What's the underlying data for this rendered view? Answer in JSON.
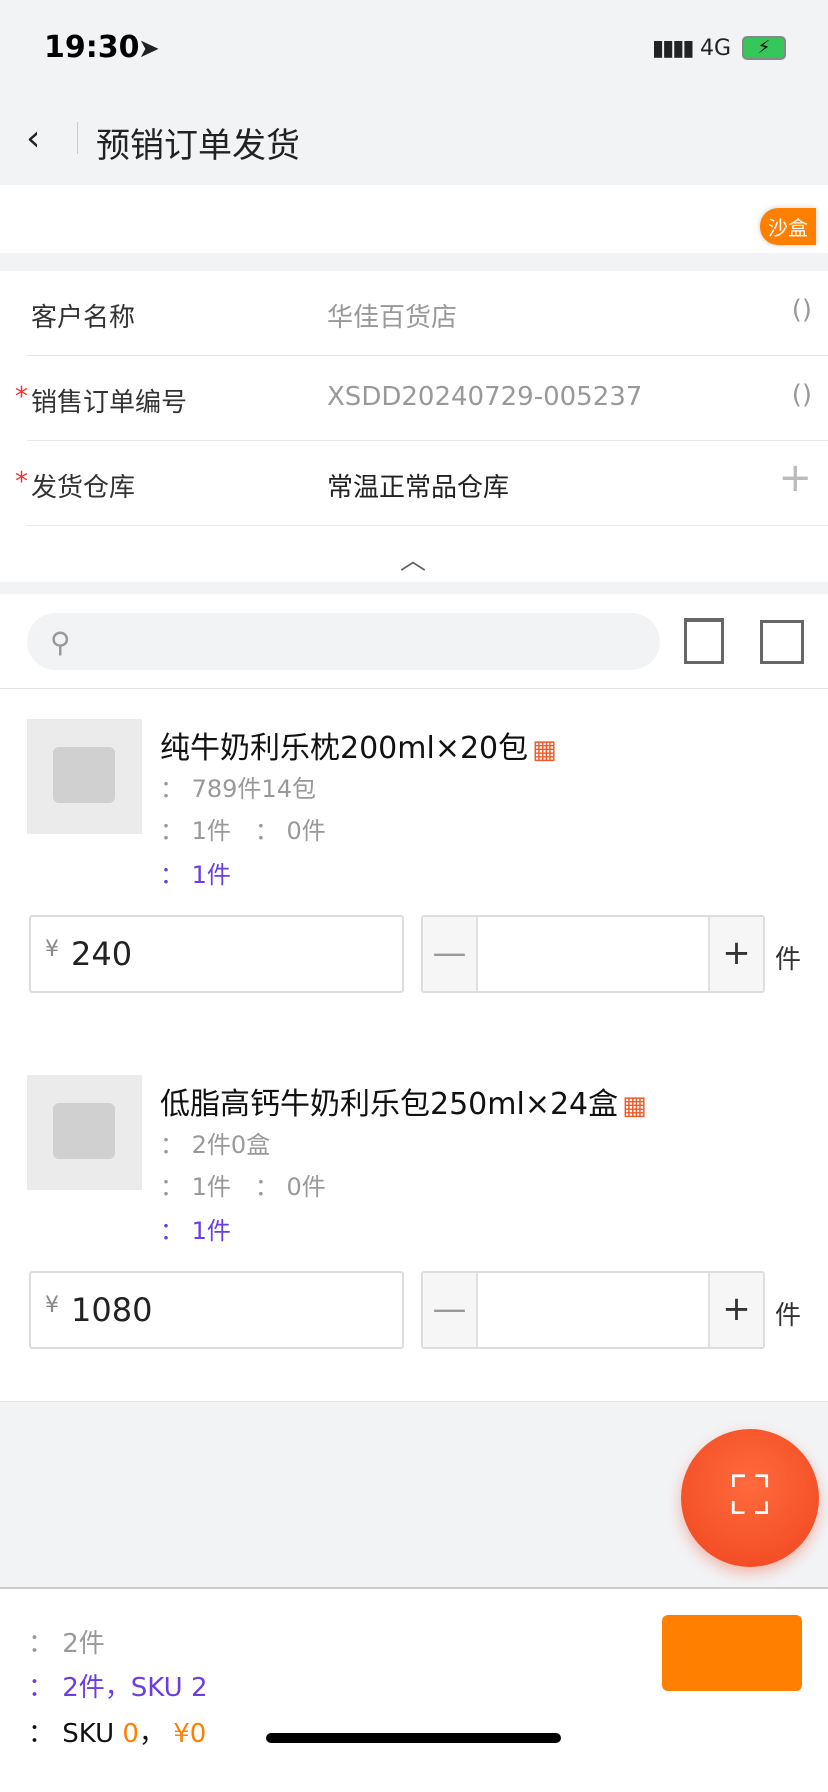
{
  "status": {
    "time": "19:30",
    "network": "4G"
  },
  "nav": {
    "title": "预销订单发货"
  },
  "sandbox": {
    "label": "沙盒"
  },
  "form": {
    "rows": [
      {
        "label": "客户名称",
        "value": "华佳百货店",
        "action": "()",
        "required": false
      },
      {
        "label": "销售订单编号",
        "value": "XSDD20240729-005237",
        "action": "()",
        "required": true
      },
      {
        "label": "发货仓库",
        "value": "常温正常品仓库",
        "action": "+",
        "required": true
      }
    ],
    "required_mark": "*",
    "collapse": "︿"
  },
  "search": {
    "placeholder": ""
  },
  "products": [
    {
      "name": "纯牛奶利乐枕200ml×20包",
      "stock": "： 789件14包",
      "line2": "： 1件　： 0件",
      "line3": "： 1件",
      "currency": "¥",
      "price": "240",
      "qty": "",
      "unit": "件"
    },
    {
      "name": "低脂高钙牛奶利乐包250ml×24盒",
      "stock": "： 2件0盒",
      "line2": "： 1件　： 0件",
      "line3": "： 1件",
      "currency": "¥",
      "price": "1080",
      "qty": "",
      "unit": "件"
    }
  ],
  "stepper": {
    "minus": "—",
    "plus": "+"
  },
  "footer": {
    "line1": "： 2件",
    "line2": "： 2件，SKU 2",
    "line3_prefix": "： SKU ",
    "line3_sku": "0",
    "line3_sep": "，",
    "line3_amount": "¥0"
  },
  "colors": {
    "accent": "#ff8000",
    "purple": "#6a3ee0",
    "fab": "#f0451f"
  }
}
